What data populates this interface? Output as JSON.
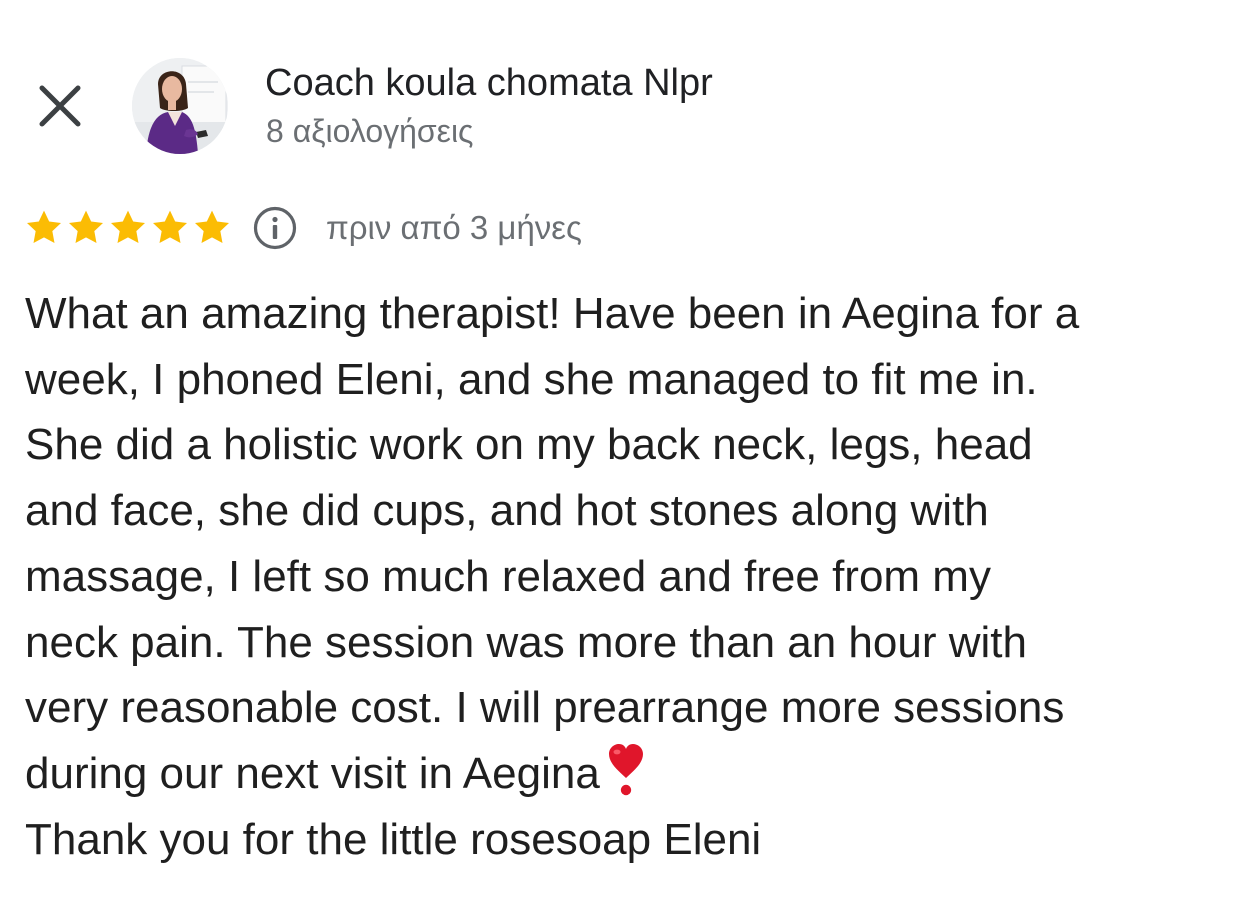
{
  "header": {
    "close_icon": "close-icon",
    "avatar_alt": "reviewer-avatar",
    "reviewer_name": "Coach koula chomata Nlpr",
    "review_count": "8 αξιολογήσεις"
  },
  "rating": {
    "stars": 5,
    "max_stars": 5,
    "star_color": "#fbbc04",
    "info_icon": "info-icon",
    "time_ago": "πριν από 3 μήνες"
  },
  "review": {
    "lines": [
      "What an amazing therapist! Have been in Aegina for a",
      "week, I phoned Eleni, and she managed to fit me in.",
      "She did a holistic work on my back neck, legs, head",
      "and face, she did cups, and hot stones along with",
      "massage, I left so much relaxed and free from my",
      "neck pain. The session was more than an hour with",
      "very reasonable cost. I will prearrange more sessions",
      "during our next visit in Aegina",
      "Thank you for the little rosesoap Eleni"
    ],
    "emoji": "heart-exclamation-icon"
  },
  "colors": {
    "text_primary": "#1f1f1f",
    "text_secondary": "#6b6f73",
    "icon_gray": "#5f6368",
    "heart_red": "#e0162b"
  }
}
